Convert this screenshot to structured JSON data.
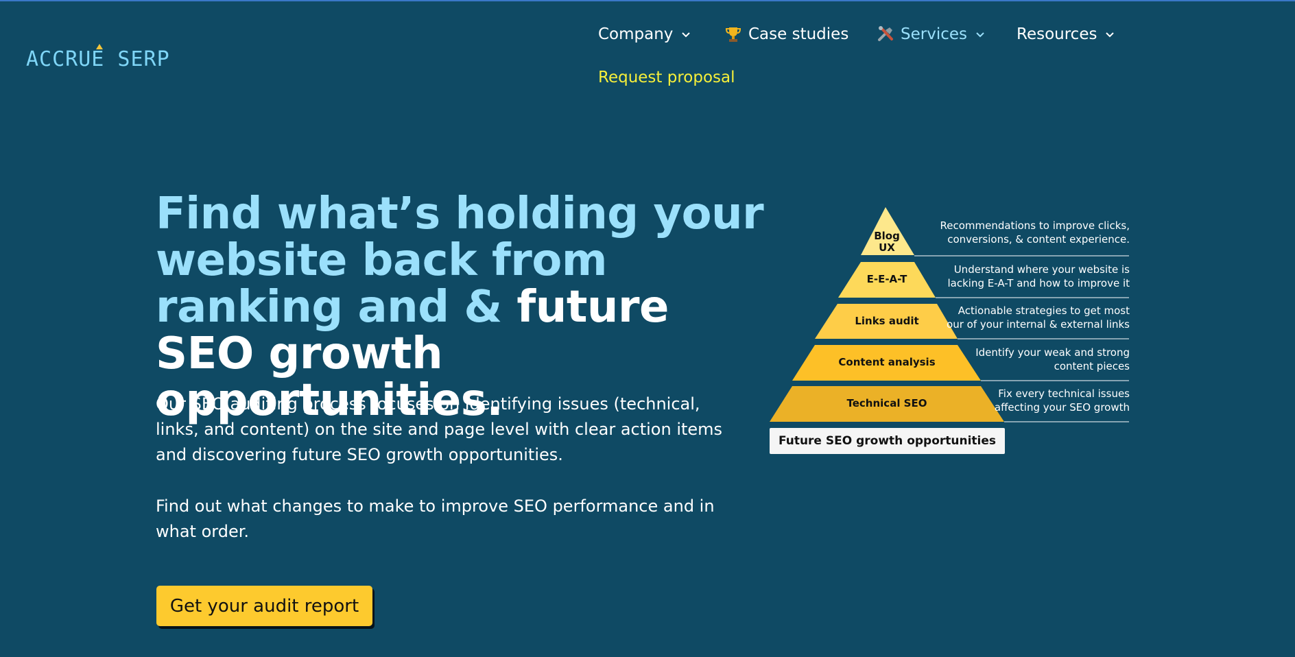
{
  "brand": {
    "logo_text": "ACCRUE SERP",
    "accent": "#f4c53a"
  },
  "nav": {
    "company": "Company",
    "case_studies": "Case studies",
    "case_studies_icon": "trophy-icon",
    "services": "Services",
    "services_icon": "tools-icon",
    "resources": "Resources",
    "request": "Request proposal"
  },
  "hero": {
    "headline_highlight": "Find what’s holding your website back from ranking and & ",
    "headline_white": "future SEO growth opportunities.",
    "paragraph1": "Our SEO auditing process focuses on identifying issues (technical, links, and content) on the site and page level with clear action items and discovering future SEO growth opportunities.",
    "paragraph2": "Find out what changes to make to improve SEO performance and in what order.",
    "cta": "Get your audit report"
  },
  "pyramid": {
    "levels": [
      {
        "label_line1": "Blog",
        "label_line2": "UX",
        "desc_line1": "Recommendations to improve clicks,",
        "desc_line2": "conversions, & content experience."
      },
      {
        "label": "E-E-A-T",
        "desc_line1": "Understand where your website is",
        "desc_line2": "lacking E-A-T and how to improve it"
      },
      {
        "label": "Links audit",
        "desc_line1": "Actionable strategies to get most",
        "desc_line2": "our of your internal & external links"
      },
      {
        "label": "Content analysis",
        "desc_line1": "Identify your weak and strong",
        "desc_line2": "content pieces"
      },
      {
        "label": "Technical SEO",
        "desc_line1": "Fix every technical issues",
        "desc_line2": "affecting your SEO growth"
      }
    ],
    "base": "Future SEO growth opportunities"
  },
  "colors": {
    "background": "#0f4a64",
    "headline_highlight": "#9be0fb",
    "request_link": "#f6ef3a",
    "cta_bg": "#fdca2e"
  }
}
